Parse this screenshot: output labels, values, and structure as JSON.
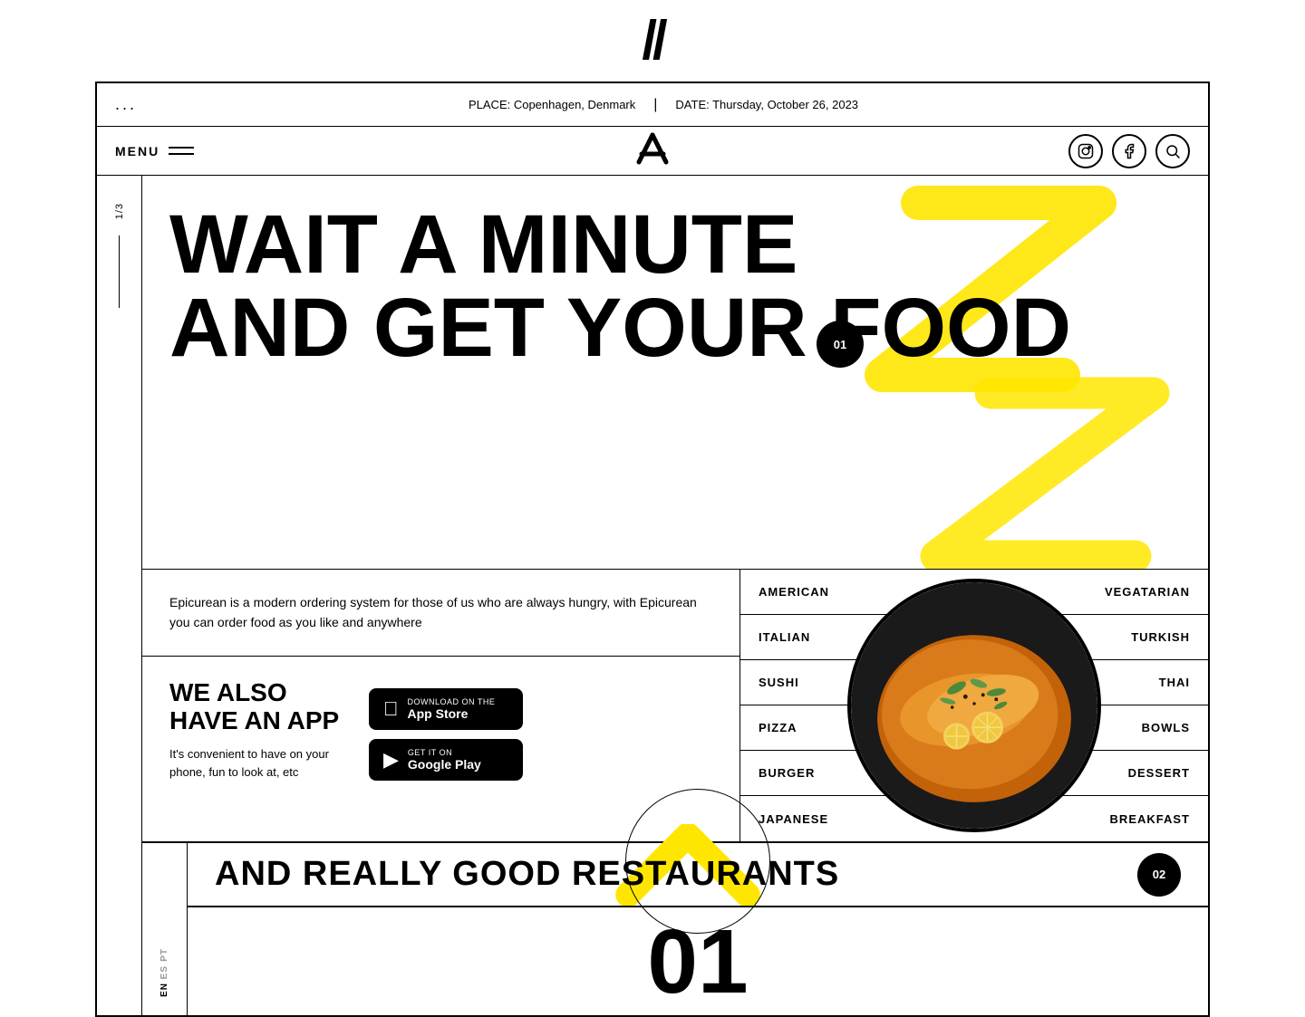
{
  "logo": {
    "symbol": "//",
    "nav_symbol": "//"
  },
  "browser": {
    "dots": "...",
    "place_label": "PLACE: Copenhagen, Denmark",
    "divider": "|",
    "date_label": "DATE: Thursday, October 26, 2023"
  },
  "navbar": {
    "menu_label": "MENU",
    "icons": {
      "instagram": "instagram-icon",
      "facebook": "facebook-icon",
      "search": "search-icon"
    }
  },
  "slide": {
    "counter": "1/3"
  },
  "hero": {
    "title_line1": "WAIT A MINUTE",
    "title_line2": "AND GET YOUR FOOD",
    "badge": "01"
  },
  "description": {
    "text": "Epicurean is a modern ordering system for those of us who are always hungry, with Epicurean you can order food as you like and anywhere"
  },
  "app_promo": {
    "title_line1": "WE ALSO",
    "title_line2": "HAVE AN APP",
    "body": "It's convenient to have on your phone, fun to look at, etc",
    "appstore": {
      "small": "Download on the",
      "big": "App Store",
      "icon": "apple-icon"
    },
    "googleplay": {
      "small": "GET IT ON",
      "big": "Google Play",
      "icon": "play-icon"
    }
  },
  "categories": [
    {
      "left": "AMERICAN",
      "right": "VEGATARIAN"
    },
    {
      "left": "ITALIAN",
      "right": "TURKISH"
    },
    {
      "left": "SUSHI",
      "right": "THAI"
    },
    {
      "left": "PIZZA",
      "right": "BOWLS"
    },
    {
      "left": "BURGER",
      "right": "DESSERT"
    },
    {
      "left": "JAPANESE",
      "right": "BREAKFAST"
    }
  ],
  "bottom": {
    "restaurant_title": "AND REALLY GOOD RESTAURANTS",
    "badge": "02",
    "big_number": "01"
  },
  "languages": [
    {
      "code": "PT",
      "active": false
    },
    {
      "code": "ES",
      "active": false
    },
    {
      "code": "EN",
      "active": true
    }
  ]
}
